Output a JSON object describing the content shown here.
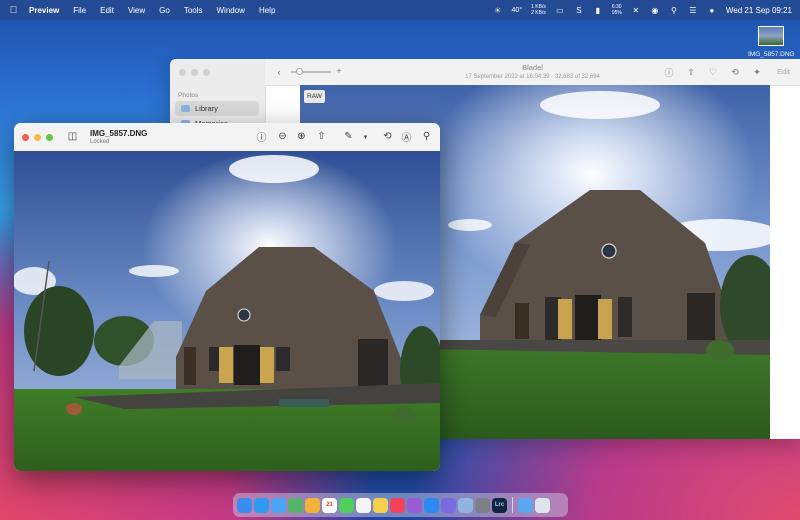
{
  "menubar": {
    "app_name": "Preview",
    "menus": [
      "File",
      "Edit",
      "View",
      "Go",
      "Tools",
      "Window",
      "Help"
    ],
    "status": {
      "temperature": "40°",
      "net_up": "1 KB/s",
      "net_down": "2 KB/s",
      "battery_time": "6:30",
      "battery_percent": "95%",
      "clock": "Wed 21 Sep  09:21"
    }
  },
  "desktop": {
    "file_label": "IMG_5857.DNG"
  },
  "back_window": {
    "sidebar_section": "Photos",
    "sidebar_items": [
      "Library",
      "Memories"
    ],
    "title": "Bladel",
    "subtitle": "17 September 2022 at 16:04:39  ·  32,683 of 32,694",
    "edit_label": "Edit",
    "raw_badge": "RAW"
  },
  "front_window": {
    "file_name": "IMG_5857.DNG",
    "status": "Locked"
  },
  "dock": {
    "items": [
      {
        "name": "finder",
        "color": "#3b8cf0",
        "label": ""
      },
      {
        "name": "safari",
        "color": "#2f9bf0",
        "label": ""
      },
      {
        "name": "mail",
        "color": "#4aa6f5",
        "label": ""
      },
      {
        "name": "maps",
        "color": "#56b36a",
        "label": ""
      },
      {
        "name": "photos",
        "color": "#f1b13b",
        "label": ""
      },
      {
        "name": "calendar",
        "color": "#ffffff",
        "label": "21"
      },
      {
        "name": "messages",
        "color": "#4fcf5c",
        "label": ""
      },
      {
        "name": "reminders",
        "color": "#f4f4f4",
        "label": ""
      },
      {
        "name": "notes",
        "color": "#f6d04d",
        "label": ""
      },
      {
        "name": "music",
        "color": "#f8415b",
        "label": ""
      },
      {
        "name": "podcasts-like",
        "color": "#9a5cd6",
        "label": ""
      },
      {
        "name": "app-store",
        "color": "#2e8af2",
        "label": ""
      },
      {
        "name": "mascot-app",
        "color": "#7a6be0",
        "label": ""
      },
      {
        "name": "preview",
        "color": "#8fb4e0",
        "label": ""
      },
      {
        "name": "system-settings",
        "color": "#7f7f88",
        "label": ""
      },
      {
        "name": "lightroom-classic",
        "color": "#0f2540",
        "label": "Lrc"
      }
    ],
    "right_items": [
      {
        "name": "downloads-folder",
        "color": "#5aa8f0",
        "label": ""
      },
      {
        "name": "trash",
        "color": "#dfe4ea",
        "label": ""
      }
    ]
  }
}
